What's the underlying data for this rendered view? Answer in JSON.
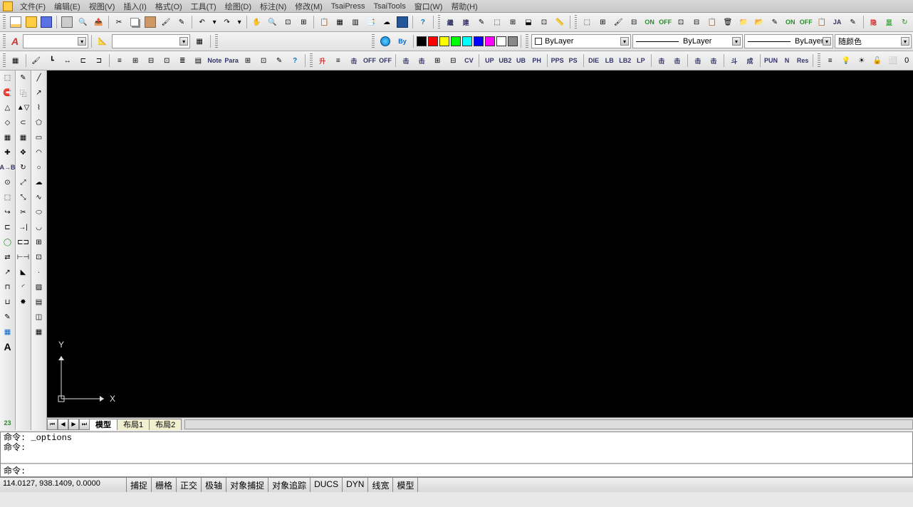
{
  "menu": {
    "items": [
      "文件(F)",
      "编辑(E)",
      "视图(V)",
      "插入(I)",
      "格式(O)",
      "工具(T)",
      "绘图(D)",
      "标注(N)",
      "修改(M)",
      "TsaiPress",
      "TsaiTools",
      "窗口(W)",
      "帮助(H)"
    ]
  },
  "layer_combo": {
    "value": "ByLayer"
  },
  "linetype_combo": {
    "value": "ByLayer"
  },
  "lineweight_combo": {
    "value": "ByLayer"
  },
  "color_combo": {
    "value": "随颜色"
  },
  "style_combo": {
    "value": ""
  },
  "dim_combo": {
    "value": ""
  },
  "layer_sym_count": "0",
  "color_swatches": [
    "#000000",
    "#ff0000",
    "#ffff00",
    "#00ff00",
    "#00ffff",
    "#0000ff",
    "#ff00ff",
    "#ffffff",
    "#888888"
  ],
  "tab_row1": [
    "升",
    "",
    "击",
    "OFF",
    "OFF",
    "",
    "击",
    "击",
    "",
    "",
    "CV",
    "",
    "UP",
    "UB2",
    "UB",
    "PH",
    "",
    "PPS",
    "PS",
    "",
    "DIE",
    "LB",
    "LB2",
    "LP",
    "",
    "击",
    "击",
    "",
    "击",
    "击",
    "",
    "斗",
    "成",
    "",
    "PUN",
    "N",
    "Res"
  ],
  "tab_row2": [
    "繼",
    "建",
    "",
    "",
    "",
    "",
    "",
    "",
    "",
    "",
    "",
    "",
    "",
    "",
    "",
    "",
    "",
    "",
    "",
    "ON",
    "OFF",
    "",
    "",
    "",
    "",
    "",
    "",
    "",
    "ON",
    "OFF",
    "",
    "JA",
    "",
    "",
    "隐",
    "显",
    ""
  ],
  "tabs": {
    "model": "模型",
    "layout1": "布局1",
    "layout2": "布局2"
  },
  "ucs": {
    "x": "X",
    "y": "Y"
  },
  "command": {
    "history_line1": "命令: _options",
    "history_line2": "命令:",
    "prompt": "命令:"
  },
  "status": {
    "coords": "114.0127, 938.1409, 0.0000",
    "toggles": [
      "捕捉",
      "栅格",
      "正交",
      "极轴",
      "对象捕捉",
      "对象追踪",
      "DUCS",
      "DYN",
      "线宽",
      "模型"
    ]
  },
  "styleA": "A",
  "num23": "23"
}
